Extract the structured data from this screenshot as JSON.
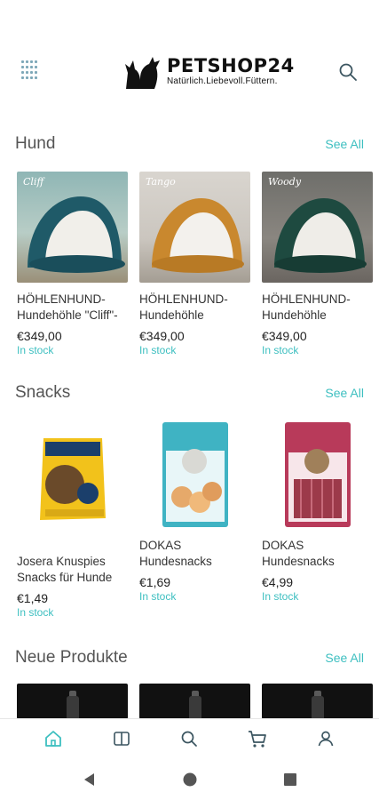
{
  "header": {
    "brand_title": "PETSHOP24",
    "brand_tagline": "Natürlich.Liebevoll.Füttern."
  },
  "sections": {
    "hund": {
      "title": "Hund",
      "see_all": "See All",
      "products": [
        {
          "label": "Cliff",
          "name": "HÖHLENHUND-Hundehöhle \"Cliff\"-",
          "price": "€349,00",
          "stock": "In stock",
          "color": "#1f5a68"
        },
        {
          "label": "Tango",
          "name": "HÖHLENHUND-Hundehöhle",
          "price": "€349,00",
          "stock": "In stock",
          "color": "#c9882e"
        },
        {
          "label": "Woody",
          "name": "HÖHLENHUND-Hundehöhle",
          "price": "€349,00",
          "stock": "In stock",
          "color": "#1e4a40"
        }
      ]
    },
    "snacks": {
      "title": "Snacks",
      "see_all": "See All",
      "products": [
        {
          "name": "Josera Knuspies Snacks für Hunde",
          "price": "€1,49",
          "stock": "In stock",
          "brand": "Josera"
        },
        {
          "name": "DOKAS Hundesnacks",
          "price": "€1,69",
          "stock": "In stock",
          "brand": "DOKAS"
        },
        {
          "name": "DOKAS Hundesnacks",
          "price": "€4,99",
          "stock": "In stock",
          "brand": "DOKAS"
        }
      ]
    },
    "neue": {
      "title": "Neue Produkte",
      "see_all": "See All"
    }
  },
  "colors": {
    "accent": "#3dbfc0",
    "nav_active": "#3dbfc0"
  },
  "bottom_nav": [
    "home-icon",
    "catalog-icon",
    "search-icon",
    "cart-icon",
    "account-icon"
  ],
  "system_nav": [
    "back-icon",
    "home-circle-icon",
    "recents-icon"
  ]
}
